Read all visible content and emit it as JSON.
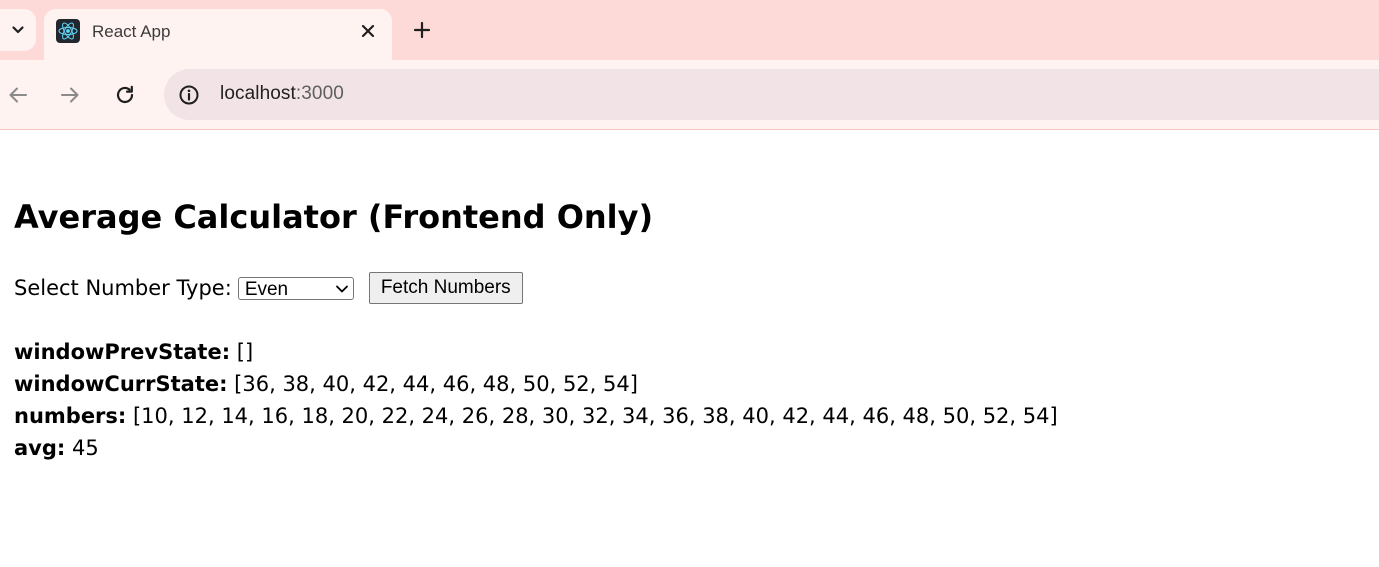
{
  "browser": {
    "tab_title": "React App",
    "url_host": "localhost",
    "url_port": ":3000"
  },
  "icons": {
    "tab_search": "chevron-down-icon",
    "favicon": "react-icon",
    "tab_close": "close-icon",
    "new_tab": "plus-icon",
    "back": "arrow-left-icon",
    "forward": "arrow-right-icon",
    "reload": "reload-icon",
    "site_info": "info-icon"
  },
  "colors": {
    "tabstrip": "#fdd9d7",
    "active_tab": "#fff3f2",
    "omnibox": "#f2e3e6",
    "react_blue": "#61dafb"
  },
  "page": {
    "title": "Average Calculator (Frontend Only)",
    "select_label": "Select Number Type:",
    "select_value": "Even",
    "fetch_button": "Fetch Numbers",
    "results": [
      {
        "label": "windowPrevState:",
        "value": " []"
      },
      {
        "label": "windowCurrState:",
        "value": " [36, 38, 40, 42, 44, 46, 48, 50, 52, 54]"
      },
      {
        "label": "numbers:",
        "value": " [10, 12, 14, 16, 18, 20, 22, 24, 26, 28, 30, 32, 34, 36, 38, 40, 42, 44, 46, 48, 50, 52, 54]"
      },
      {
        "label": "avg:",
        "value": " 45"
      }
    ]
  }
}
